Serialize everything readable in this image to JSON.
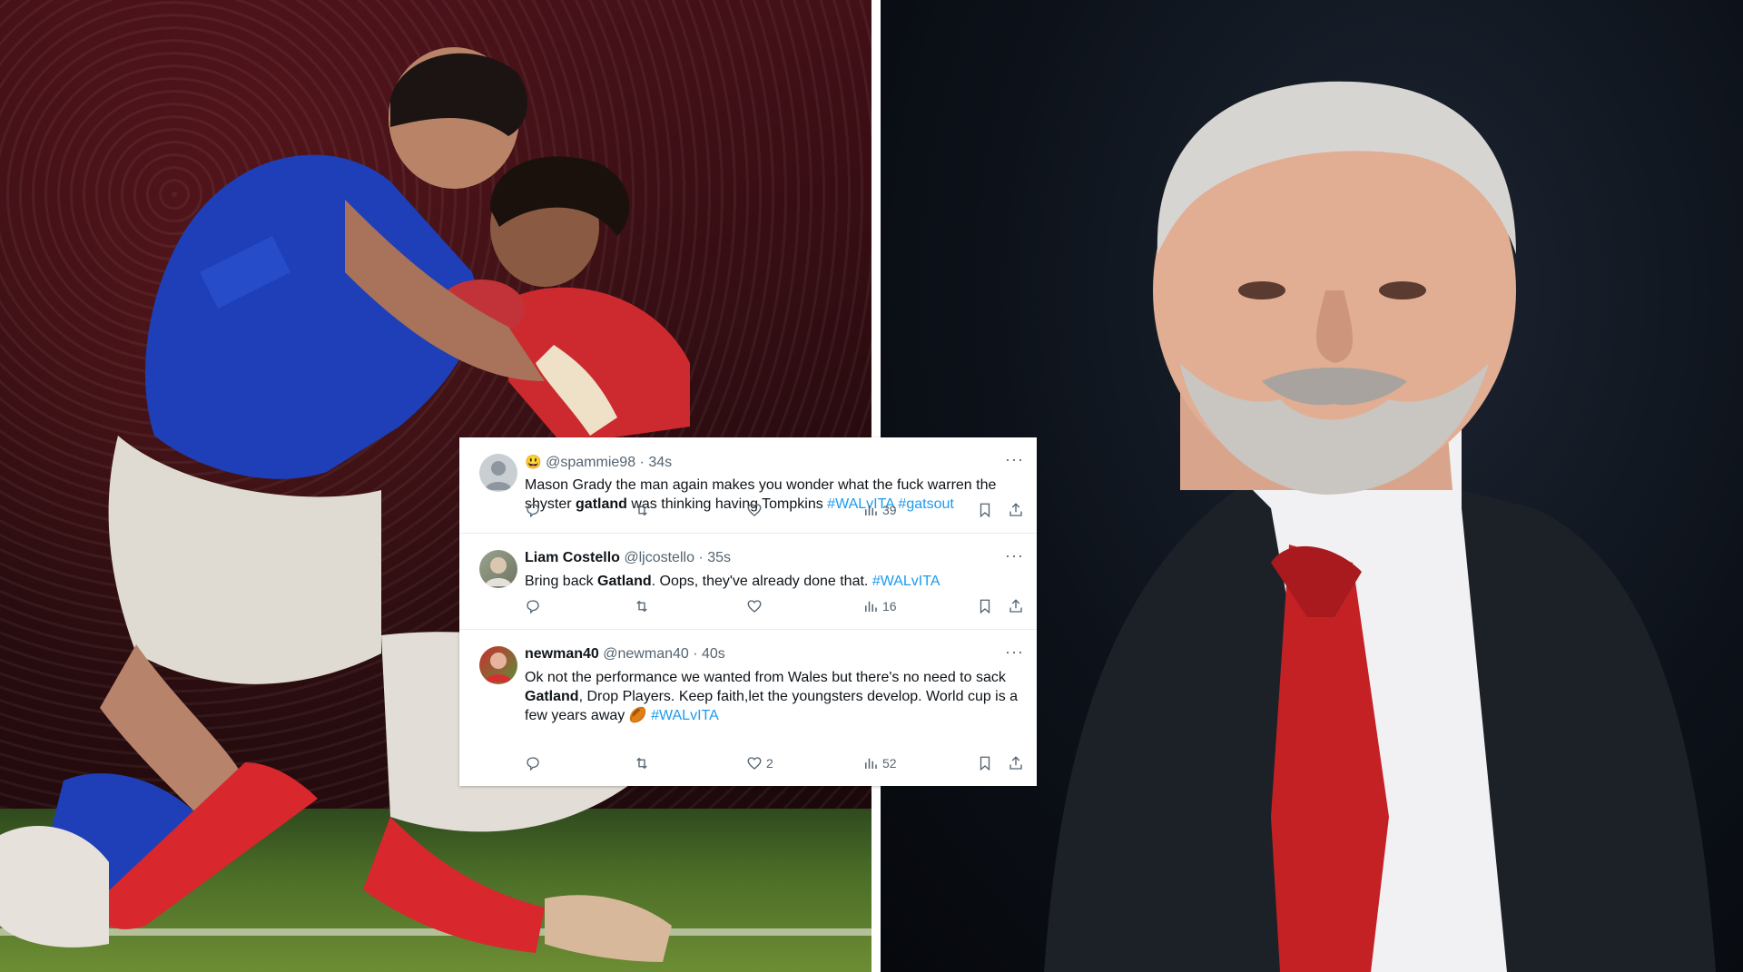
{
  "tweets": [
    {
      "emoji": "😃",
      "name": "",
      "handle": "@spammie98",
      "time": "· 34s",
      "body": {
        "p1": "Mason Grady the man again makes you wonder what the fuck warren the shyster ",
        "bold1": "gatland",
        "p2": " was thinking having Tompkins ",
        "tag1": "#WALvITA",
        "tag2": "#gatsout"
      },
      "replies": "",
      "retweets": "",
      "likes": "",
      "views": "39"
    },
    {
      "name": "Liam Costello",
      "handle": "@ljcostello",
      "time": "· 35s",
      "body": {
        "p1": "Bring back ",
        "bold1": "Gatland",
        "p2": ". Oops, they've already done that. ",
        "tag1": "#WALvITA"
      },
      "replies": "",
      "retweets": "",
      "likes": "",
      "views": "16"
    },
    {
      "name": "newman40",
      "handle": "@newman40",
      "time": "· 40s",
      "body": {
        "p1": "Ok not the performance we wanted from Wales but there's no need to sack ",
        "bold1": "Gatland",
        "p2": ", Drop Players. Keep faith,let the youngsters develop. World cup is a few years away ",
        "emoji": "🏉",
        "tag1": "#WALvITA"
      },
      "replies": "",
      "retweets": "",
      "likes": "2",
      "views": "52"
    }
  ],
  "more_label": "···",
  "colors": {
    "hashtag": "#1d9bf0",
    "meta": "#536471",
    "text": "#0f1419"
  }
}
